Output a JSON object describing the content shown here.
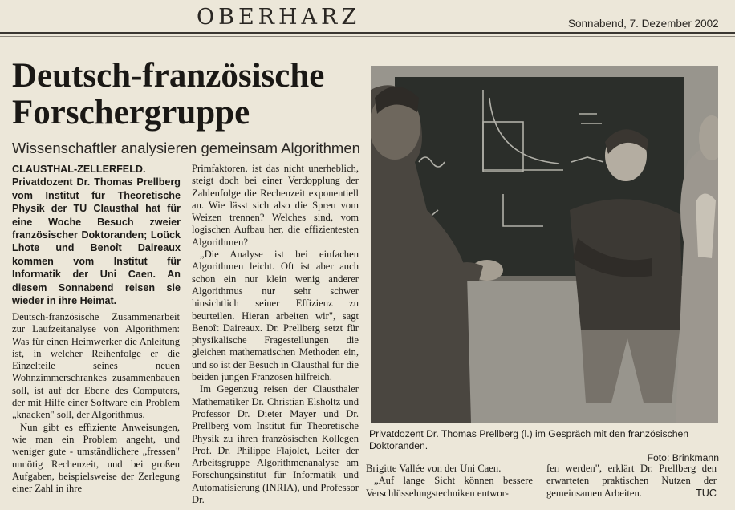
{
  "header": {
    "section": "OBERHARZ",
    "date": "Sonnabend, 7. Dezember 2002"
  },
  "article": {
    "headline_line1": "Deutsch-französische",
    "headline_line2": "Forschergruppe",
    "subheadline": "Wissenschaftler analysieren gemeinsam Algorithmen",
    "lead": "CLAUSTHAL-ZELLERFELD. Privatdozent Dr. Thomas Prellberg vom Institut für Theoretische Physik der TU Clausthal hat für eine Woche Besuch zweier französischer Doktoranden; Loück Lhote und Benoît Daireaux kommen vom Institut für Informatik der Uni Caen. An diesem Sonnabend reisen sie wieder in ihre Heimat.",
    "col1_p1": "Deutsch-französische Zusammenarbeit zur Laufzeitanalyse von Algorithmen: Was für einen Heimwerker die Anleitung ist, in welcher Reihenfolge er die Einzelteile seines neuen Wohnzimmerschrankes zusammenbauen soll, ist auf der Ebene des Computers, der mit Hilfe einer Software ein Problem „knacken\" soll, der Algorithmus.",
    "col1_p2": "Nun gibt es effiziente Anweisungen, wie man ein Problem angeht, und weniger gute - umständlichere „fressen\" unnötig Rechenzeit, und bei großen Aufgaben, beispielsweise der Zerlegung einer Zahl in ihre",
    "col2_p1": "Primfaktoren, ist das nicht unerheblich, steigt doch bei einer Verdopplung der Zahlenfolge die Rechenzeit exponentiell an. Wie lässt sich also die Spreu vom Weizen trennen? Welches sind, vom logischen Aufbau her, die effizientesten Algorithmen?",
    "col2_p2": "„Die Analyse ist bei einfachen Algorithmen leicht. Oft ist aber auch schon ein nur klein wenig anderer Algorithmus nur sehr schwer hinsichtlich seiner Effizienz zu beurteilen. Hieran arbeiten wir\", sagt Benoît Daireaux. Dr. Prellberg setzt für physikalische Fragestellungen die gleichen mathematischen Methoden ein, und so ist der Besuch in Clausthal für die beiden jungen Franzosen hilfreich.",
    "col2_p3": "Im Gegenzug reisen der Clausthaler Mathematiker Dr. Christian Elsholtz und Professor Dr. Dieter Mayer und Dr. Prellberg vom Institut für Theoretische Physik zu ihren französischen Kollegen Prof. Dr. Philippe Flajolet, Leiter der Arbeitsgruppe Algorithmenanalyse am Forschungsinstitut für Informatik und Automatisierung (INRIA), und Professor Dr.",
    "col3a_p1": "Brigitte Vallée von der Uni Caen.",
    "col3a_p2": "„Auf lange Sicht können bessere Verschlüsselungstechniken entwor-",
    "col3b_p1": "fen werden\", erklärt Dr. Prellberg den erwarteten praktischen Nutzen der gemeinsamen Arbeiten.",
    "col3b_sig": "TUC"
  },
  "photo": {
    "caption": "Privatdozent Dr. Thomas Prellberg (l.) im Gespräch mit den französischen Doktoranden.",
    "credit": "Foto: Brinkmann"
  },
  "colors": {
    "paper": "#ece7d9",
    "ink": "#1c1a17",
    "chalkboard": "#2b2e2a"
  }
}
